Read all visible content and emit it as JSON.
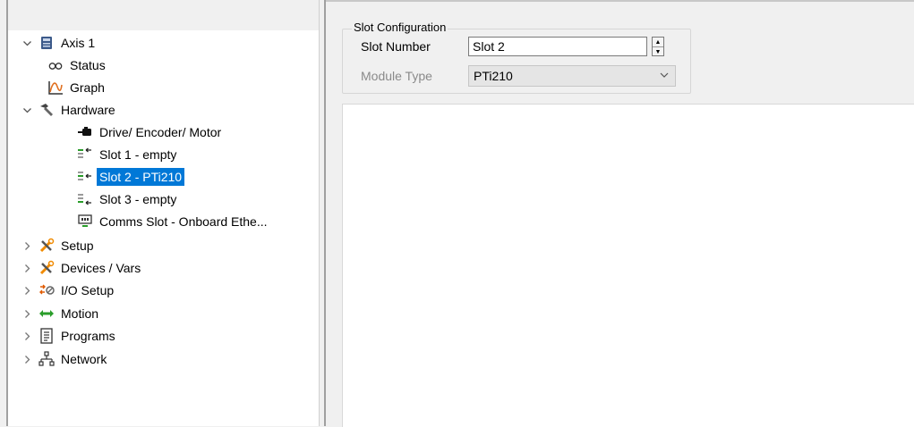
{
  "tree": {
    "items": [
      {
        "label": "Axis 1",
        "icon": "axis-drive-icon",
        "expander": "expanded"
      },
      {
        "label": "Status",
        "icon": "status-eyes-icon"
      },
      {
        "label": "Graph",
        "icon": "graph-icon"
      },
      {
        "label": "Hardware",
        "icon": "hardware-hammer-icon",
        "expander": "expanded"
      },
      {
        "label": "Drive/ Encoder/ Motor",
        "icon": "motor-icon"
      },
      {
        "label": "Slot 1 - empty",
        "icon": "slot-icon"
      },
      {
        "label": "Slot 2 - PTi210",
        "icon": "slot-icon",
        "selected": true
      },
      {
        "label": "Slot 3 - empty",
        "icon": "slot-icon"
      },
      {
        "label": "Comms Slot - Onboard Ethe...",
        "icon": "comms-slot-icon"
      },
      {
        "label": "Setup",
        "icon": "setup-tools-icon",
        "expander": "collapsed"
      },
      {
        "label": "Devices / Vars",
        "icon": "devices-tools-icon",
        "expander": "collapsed"
      },
      {
        "label": "I/O Setup",
        "icon": "io-setup-icon",
        "expander": "collapsed"
      },
      {
        "label": "Motion",
        "icon": "motion-arrows-icon",
        "expander": "collapsed"
      },
      {
        "label": "Programs",
        "icon": "programs-document-icon",
        "expander": "collapsed"
      },
      {
        "label": "Network",
        "icon": "network-icon",
        "expander": "collapsed"
      }
    ]
  },
  "slot_config": {
    "title": "Slot Configuration",
    "slot_number_label": "Slot Number",
    "slot_number_value": "Slot 2",
    "module_type_label": "Module Type",
    "module_type_value": "PTi210"
  },
  "colors": {
    "selection": "#0078d7",
    "panel_bg": "#f0f0f0"
  }
}
